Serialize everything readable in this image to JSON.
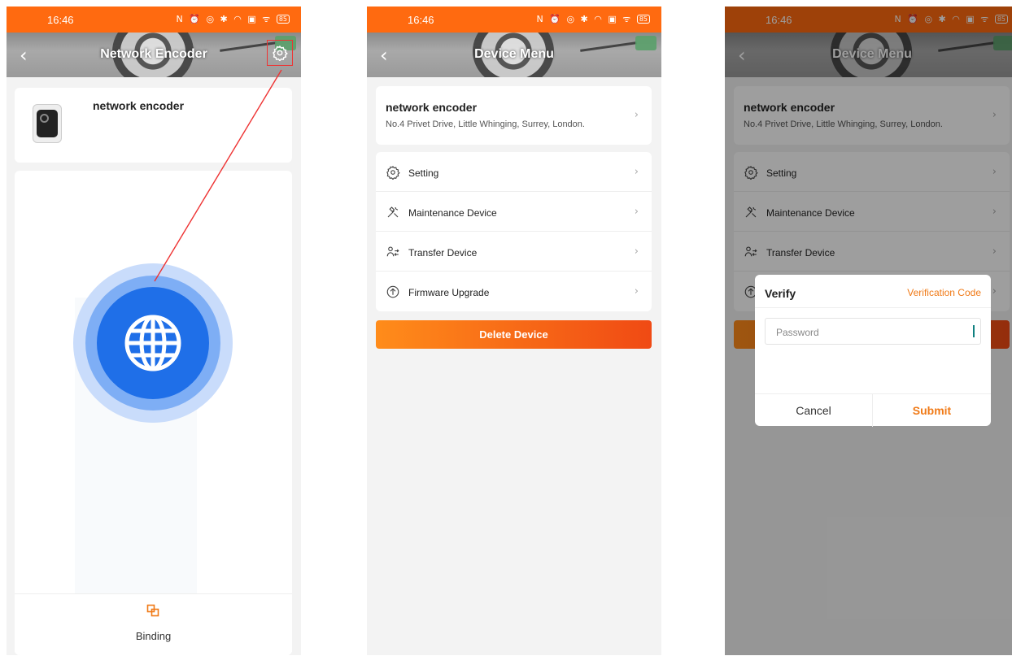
{
  "status_bar": {
    "time": "16:46",
    "icons": "N ⏰ ◎ ✱ ◠ ▣ ᯤ",
    "battery": "85"
  },
  "screen1": {
    "title": "Network Encoder",
    "device_name": "network encoder",
    "binding_label": "Binding",
    "accent": "#ff6a10",
    "globe_color": "#1f6fe8"
  },
  "screen2": {
    "title": "Device Menu",
    "device_name": "network encoder",
    "address": "No.4 Privet Drive, Little Whinging, Surrey, London.",
    "menu": [
      {
        "label": "Setting",
        "icon": "gear-icon"
      },
      {
        "label": "Maintenance Device",
        "icon": "tools-icon"
      },
      {
        "label": "Transfer Device",
        "icon": "transfer-icon"
      },
      {
        "label": "Firmware Upgrade",
        "icon": "upgrade-icon"
      }
    ],
    "delete_label": "Delete Device"
  },
  "screen3": {
    "title": "Device Menu",
    "device_name": "network encoder",
    "address": "No.4 Privet Drive, Little Whinging, Surrey, London.",
    "menu": [
      {
        "label": "Setting",
        "icon": "gear-icon"
      },
      {
        "label": "Maintenance Device",
        "icon": "tools-icon"
      },
      {
        "label": "Transfer Device",
        "icon": "transfer-icon"
      },
      {
        "label": "",
        "icon": "upgrade-icon"
      }
    ],
    "dialog": {
      "title": "Verify",
      "link": "Verification Code",
      "placeholder": "Password",
      "cancel": "Cancel",
      "submit": "Submit"
    }
  }
}
